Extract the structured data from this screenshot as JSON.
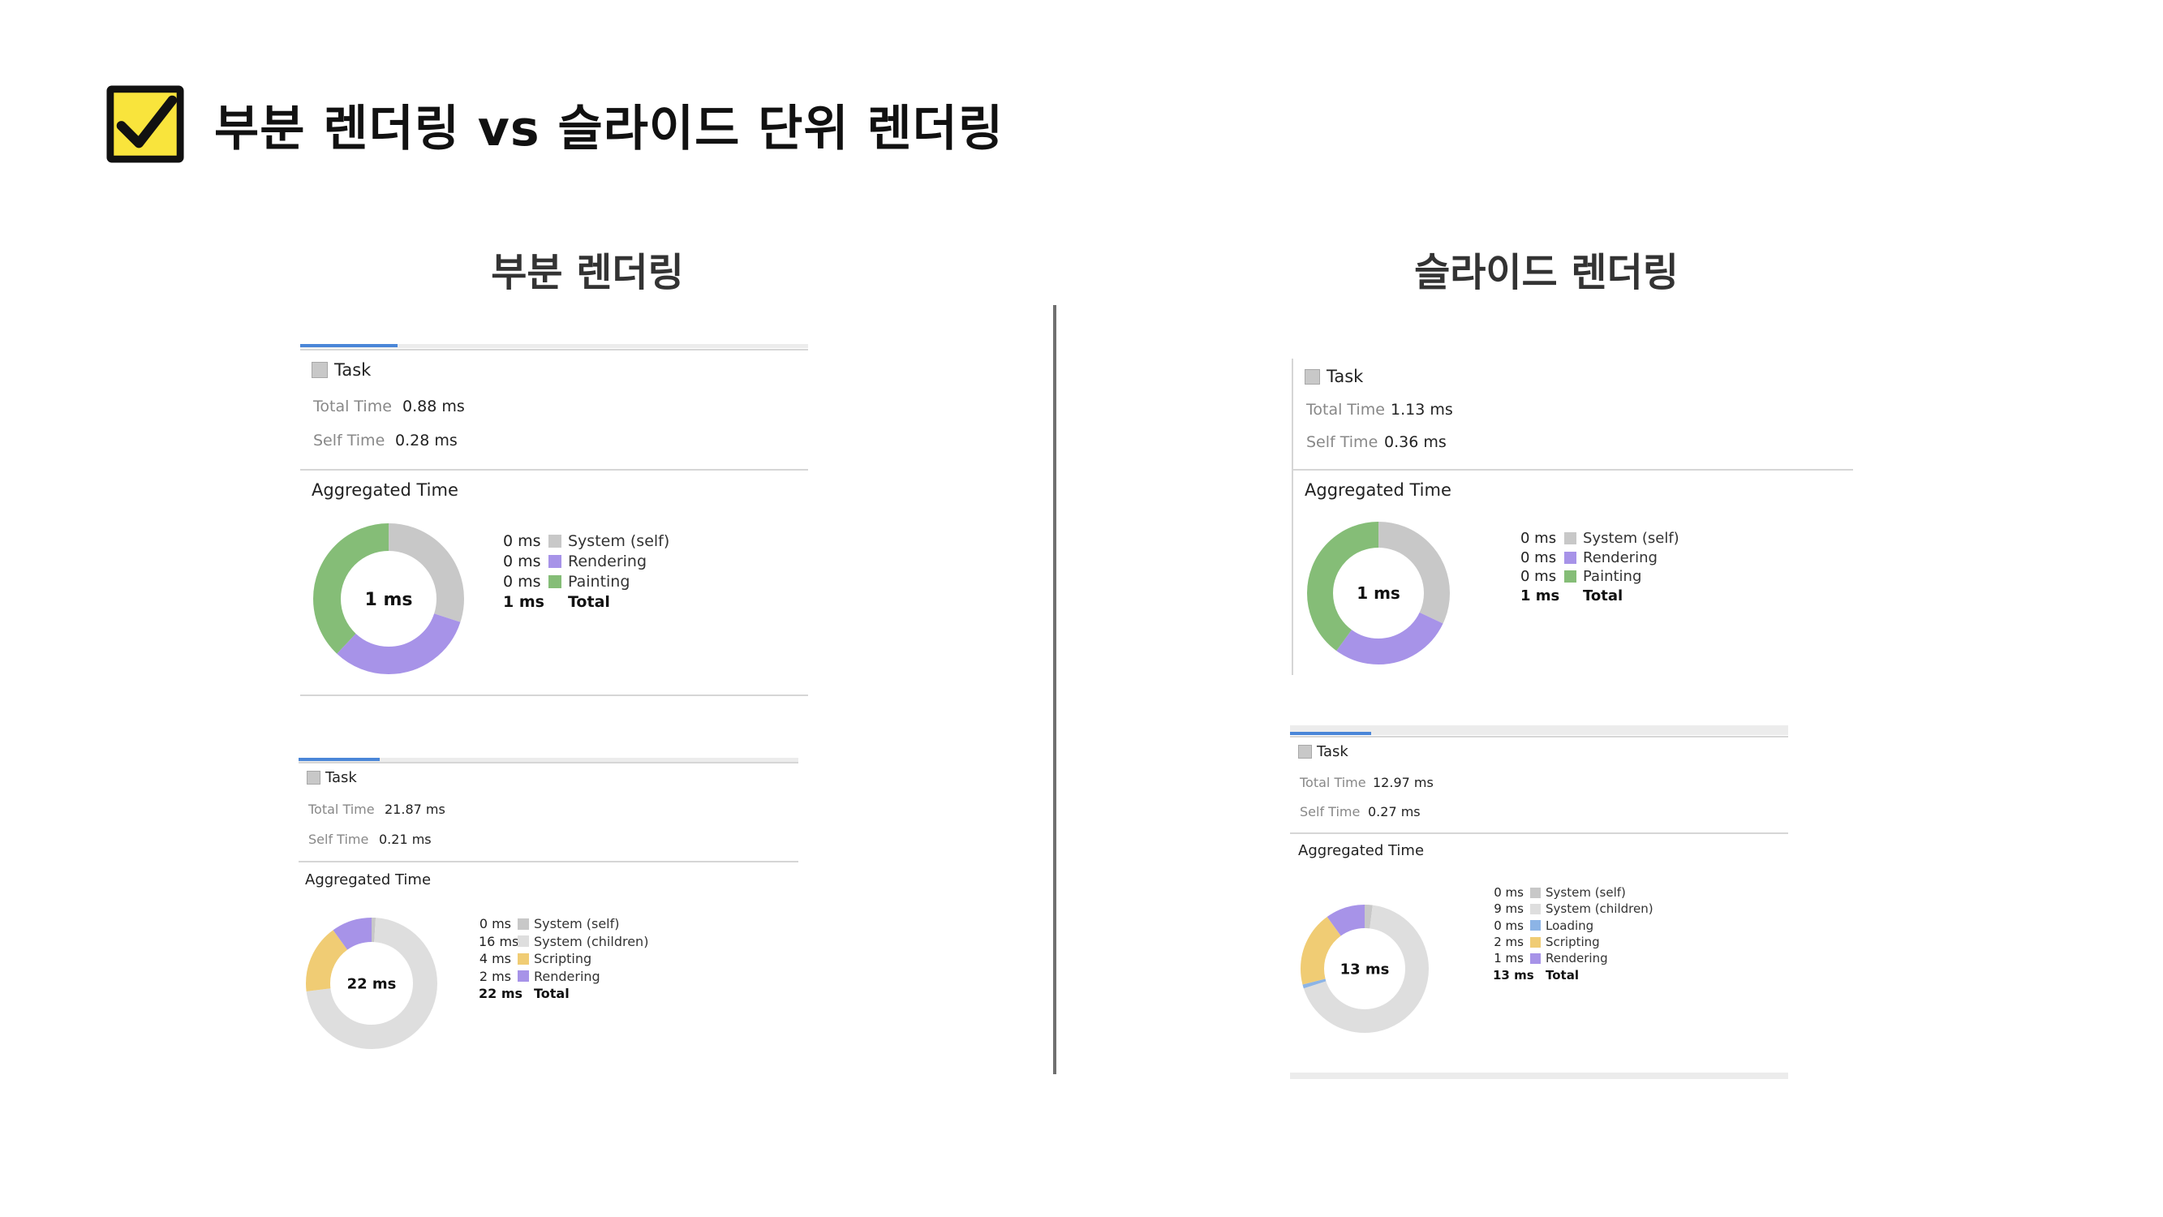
{
  "slide": {
    "title": "부분 렌더링 vs 슬라이드 단위 렌더링",
    "icon": "checkbox-checked-icon"
  },
  "colors": {
    "system": "#c8c8c8",
    "system_children": "#dedede",
    "rendering": "#a793e8",
    "painting": "#85bd77",
    "scripting": "#f0cc74",
    "loading": "#8cb4e6",
    "tab_accent": "#4a86d8"
  },
  "left": {
    "title": "부분 렌더링",
    "panels": [
      {
        "task_label": "Task",
        "total_time_label": "Total Time",
        "total_time": "0.88 ms",
        "self_time_label": "Self Time",
        "self_time": "0.28 ms",
        "aggregated_label": "Aggregated Time",
        "center_label": "1 ms",
        "legend": [
          {
            "value": "0 ms",
            "label": "System (self)",
            "color": "#c8c8c8"
          },
          {
            "value": "0 ms",
            "label": "Rendering",
            "color": "#a793e8"
          },
          {
            "value": "0 ms",
            "label": "Painting",
            "color": "#85bd77"
          },
          {
            "value": "1 ms",
            "label": "Total",
            "total": true
          }
        ],
        "donut": [
          {
            "name": "System (self)",
            "fraction": 0.3,
            "color": "#c8c8c8"
          },
          {
            "name": "Rendering",
            "fraction": 0.32,
            "color": "#a793e8"
          },
          {
            "name": "Painting",
            "fraction": 0.38,
            "color": "#85bd77"
          }
        ]
      },
      {
        "task_label": "Task",
        "total_time_label": "Total Time",
        "total_time": "21.87 ms",
        "self_time_label": "Self Time",
        "self_time": "0.21 ms",
        "aggregated_label": "Aggregated Time",
        "center_label": "22 ms",
        "legend": [
          {
            "value": "0 ms",
            "label": "System (self)",
            "color": "#c8c8c8"
          },
          {
            "value": "16 ms",
            "label": "System (children)",
            "color": "#dedede"
          },
          {
            "value": "4 ms",
            "label": "Scripting",
            "color": "#f0cc74"
          },
          {
            "value": "2 ms",
            "label": "Rendering",
            "color": "#a793e8"
          },
          {
            "value": "22 ms",
            "label": "Total",
            "total": true
          }
        ],
        "donut": [
          {
            "name": "System (self)",
            "fraction": 0.01,
            "color": "#c8c8c8"
          },
          {
            "name": "System (children)",
            "fraction": 0.72,
            "color": "#dedede"
          },
          {
            "name": "Scripting",
            "fraction": 0.17,
            "color": "#f0cc74"
          },
          {
            "name": "Rendering",
            "fraction": 0.1,
            "color": "#a793e8"
          }
        ]
      }
    ]
  },
  "right": {
    "title": "슬라이드 렌더링",
    "panels": [
      {
        "task_label": "Task",
        "total_time_label": "Total Time",
        "total_time": "1.13 ms",
        "self_time_label": "Self Time",
        "self_time": "0.36 ms",
        "aggregated_label": "Aggregated Time",
        "center_label": "1 ms",
        "legend": [
          {
            "value": "0 ms",
            "label": "System (self)",
            "color": "#c8c8c8"
          },
          {
            "value": "0 ms",
            "label": "Rendering",
            "color": "#a793e8"
          },
          {
            "value": "0 ms",
            "label": "Painting",
            "color": "#85bd77"
          },
          {
            "value": "1 ms",
            "label": "Total",
            "total": true
          }
        ],
        "donut": [
          {
            "name": "System (self)",
            "fraction": 0.32,
            "color": "#c8c8c8"
          },
          {
            "name": "Rendering",
            "fraction": 0.28,
            "color": "#a793e8"
          },
          {
            "name": "Painting",
            "fraction": 0.4,
            "color": "#85bd77"
          }
        ]
      },
      {
        "task_label": "Task",
        "total_time_label": "Total Time",
        "total_time": "12.97 ms",
        "self_time_label": "Self Time",
        "self_time": "0.27 ms",
        "aggregated_label": "Aggregated Time",
        "center_label": "13 ms",
        "legend": [
          {
            "value": "0 ms",
            "label": "System (self)",
            "color": "#c8c8c8"
          },
          {
            "value": "9 ms",
            "label": "System (children)",
            "color": "#dedede"
          },
          {
            "value": "0 ms",
            "label": "Loading",
            "color": "#8cb4e6"
          },
          {
            "value": "2 ms",
            "label": "Scripting",
            "color": "#f0cc74"
          },
          {
            "value": "1 ms",
            "label": "Rendering",
            "color": "#a793e8"
          },
          {
            "value": "13 ms",
            "label": "Total",
            "total": true
          }
        ],
        "donut": [
          {
            "name": "System (self)",
            "fraction": 0.02,
            "color": "#c8c8c8"
          },
          {
            "name": "System (children)",
            "fraction": 0.68,
            "color": "#dedede"
          },
          {
            "name": "Loading",
            "fraction": 0.01,
            "color": "#8cb4e6"
          },
          {
            "name": "Scripting",
            "fraction": 0.19,
            "color": "#f0cc74"
          },
          {
            "name": "Rendering",
            "fraction": 0.1,
            "color": "#a793e8"
          }
        ]
      }
    ]
  }
}
